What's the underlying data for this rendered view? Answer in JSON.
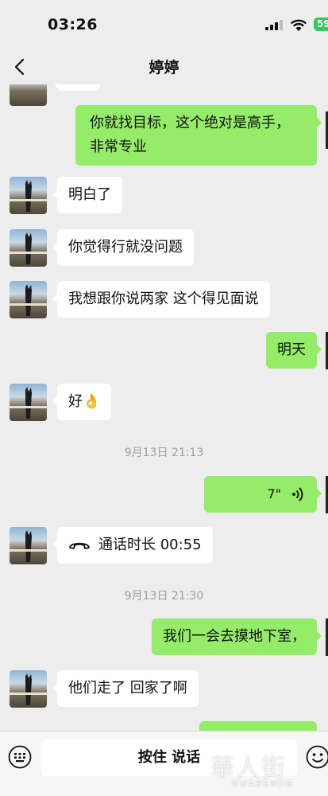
{
  "status_bar": {
    "time": "03:26",
    "battery": "59"
  },
  "nav": {
    "title": "婷婷"
  },
  "messages": [
    {
      "from": "me",
      "text_line1": "你就找目标，这个绝对是高手，",
      "text_line2": "非常专业"
    },
    {
      "from": "other",
      "text": "明白了"
    },
    {
      "from": "other",
      "text": "你觉得行就没问题"
    },
    {
      "from": "other",
      "text": "我想跟你说两家 这个得见面说"
    },
    {
      "from": "me",
      "text": "明天"
    },
    {
      "from": "other",
      "text": "好👌"
    },
    {
      "type": "timestamp",
      "text": "9月13日 21:13"
    },
    {
      "from": "me",
      "type": "voice",
      "duration": "7\""
    },
    {
      "from": "other",
      "type": "call",
      "text": "通话时长 00:55"
    },
    {
      "type": "timestamp",
      "text": "9月13日 21:30"
    },
    {
      "from": "me",
      "text": "我们一会去摸地下室，"
    },
    {
      "from": "other",
      "text": "他们走了 回家了啊"
    }
  ],
  "input_bar": {
    "hold_to_talk": "按住 说话"
  },
  "watermark": {
    "main": "華人街",
    "sub": "HUARENJIE"
  },
  "colors": {
    "out_bubble": "#95ec69",
    "in_bubble": "#ffffff",
    "background": "#ededed"
  }
}
